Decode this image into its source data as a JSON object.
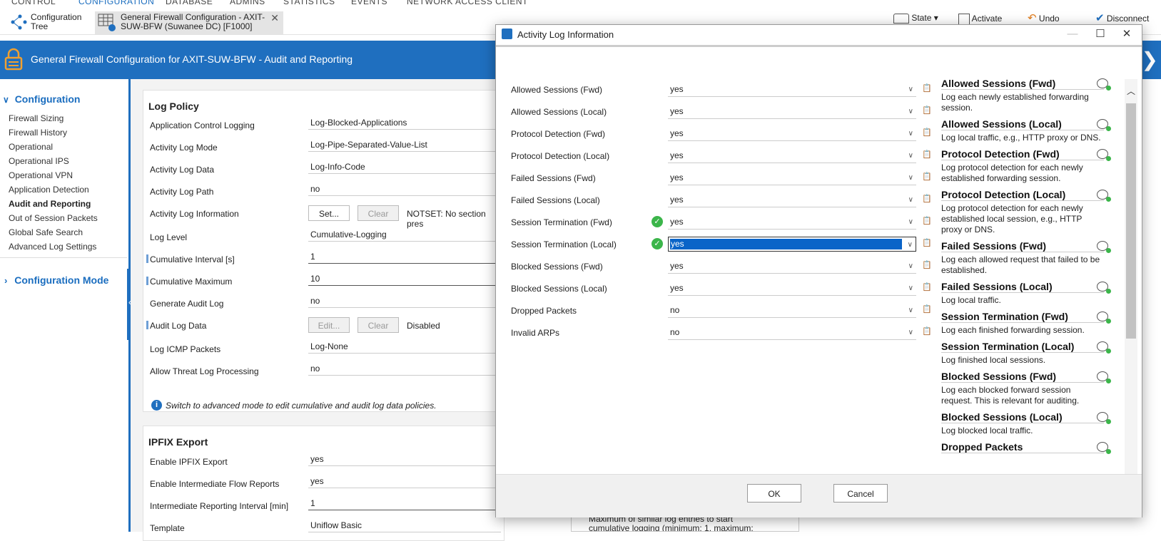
{
  "topnav": [
    "CONTROL",
    "CONFIGURATION",
    "DATABASE",
    "ADMINS",
    "STATISTICS",
    "EVENTS",
    "NETWORK ACCESS CLIENT"
  ],
  "toolbar": {
    "config_tree": [
      "Configuration",
      "Tree"
    ],
    "doc_tab": [
      "General Firewall Configuration - AXIT-",
      "SUW-BFW (Suwanee DC)  [F1000]"
    ],
    "doc_tab_close": "✕",
    "state": "State",
    "activate": "Activate",
    "undo": "Undo",
    "disconnect": "Disconnect"
  },
  "header": {
    "title": "General Firewall Configuration for AXIT-SUW-BFW - Audit and Reporting"
  },
  "sidebar": {
    "section1": "Configuration",
    "items": [
      "Firewall Sizing",
      "Firewall History",
      "Operational",
      "Operational IPS",
      "Operational VPN",
      "Application Detection",
      "Audit and Reporting",
      "Out of Session Packets",
      "Global Safe Search",
      "Advanced Log Settings"
    ],
    "section2": "Configuration Mode"
  },
  "log_policy": {
    "title": "Log Policy",
    "rows": [
      {
        "label": "Application Control Logging",
        "value": "Log-Blocked-Applications"
      },
      {
        "label": "Activity Log Mode",
        "value": "Log-Pipe-Separated-Value-List"
      },
      {
        "label": "Activity Log Data",
        "value": "Log-Info-Code"
      },
      {
        "label": "Activity Log Path",
        "value": "no"
      },
      {
        "label": "Activity Log Information",
        "value": ""
      },
      {
        "label": "Log Level",
        "value": "Cumulative-Logging"
      },
      {
        "label": "Cumulative Interval [s]",
        "value": "1"
      },
      {
        "label": "Cumulative Maximum",
        "value": "10"
      },
      {
        "label": "Generate Audit Log",
        "value": "no"
      },
      {
        "label": "Audit Log Data",
        "value": ""
      },
      {
        "label": "Log ICMP Packets",
        "value": "Log-None"
      },
      {
        "label": "Allow Threat Log Processing",
        "value": "no"
      }
    ],
    "set_button": "Set...",
    "clear_button": "Clear",
    "notset_text": "NOTSET: No section pres",
    "edit_button": "Edit...",
    "clear_button2": "Clear",
    "disabled_text": "Disabled",
    "info_text": "Switch to advanced mode to edit cumulative and audit log data policies."
  },
  "ipfix": {
    "title": "IPFIX Export",
    "rows": [
      {
        "label": "Enable IPFIX Export",
        "value": "yes"
      },
      {
        "label": "Enable Intermediate Flow Reports",
        "value": "yes"
      },
      {
        "label": "Intermediate Reporting Interval [min]",
        "value": "1"
      },
      {
        "label": "Template",
        "value": "Uniflow Basic"
      }
    ],
    "tooltip": [
      "Maximum of similar log entries to start",
      "cumulative logging (minimum: 1, maximum:"
    ]
  },
  "dialog": {
    "title": "Activity Log Information",
    "rows": [
      {
        "label": "Allowed Sessions (Fwd)",
        "value": "yes",
        "check": false
      },
      {
        "label": "Allowed Sessions (Local)",
        "value": "yes",
        "check": false
      },
      {
        "label": "Protocol Detection (Fwd)",
        "value": "yes",
        "check": false
      },
      {
        "label": "Protocol Detection (Local)",
        "value": "yes",
        "check": false
      },
      {
        "label": "Failed Sessions (Fwd)",
        "value": "yes",
        "check": false
      },
      {
        "label": "Failed Sessions (Local)",
        "value": "yes",
        "check": false
      },
      {
        "label": "Session Termination (Fwd)",
        "value": "yes",
        "check": true
      },
      {
        "label": "Session Termination (Local)",
        "value": "yes",
        "check": true,
        "selected": true
      },
      {
        "label": "Blocked Sessions (Fwd)",
        "value": "yes",
        "check": false
      },
      {
        "label": "Blocked Sessions (Local)",
        "value": "yes",
        "check": false
      },
      {
        "label": "Dropped Packets",
        "value": "no",
        "check": false
      },
      {
        "label": "Invalid ARPs",
        "value": "no",
        "check": false
      }
    ],
    "help": [
      {
        "title": "Allowed Sessions (Fwd)",
        "lines": [
          "Log each newly established forwarding",
          "session."
        ]
      },
      {
        "title": "Allowed Sessions (Local)",
        "lines": [
          "Log local traffic, e.g., HTTP proxy or DNS."
        ]
      },
      {
        "title": "Protocol Detection (Fwd)",
        "lines": [
          "Log protocol detection for each newly",
          "established forwarding session."
        ]
      },
      {
        "title": "Protocol Detection (Local)",
        "lines": [
          "Log protocol detection for each newly",
          "established local session, e.g., HTTP",
          "proxy or DNS."
        ]
      },
      {
        "title": "Failed Sessions (Fwd)",
        "lines": [
          "Log each allowed request that failed to be",
          "established."
        ]
      },
      {
        "title": "Failed Sessions (Local)",
        "lines": [
          "Log local traffic."
        ]
      },
      {
        "title": "Session Termination (Fwd)",
        "lines": [
          "Log each finished forwarding session."
        ]
      },
      {
        "title": "Session Termination (Local)",
        "lines": [
          "Log finished local sessions."
        ]
      },
      {
        "title": "Blocked Sessions (Fwd)",
        "lines": [
          "Log each blocked forward session",
          "request. This is relevant for auditing."
        ]
      },
      {
        "title": "Blocked Sessions (Local)",
        "lines": [
          "Log blocked local traffic."
        ]
      },
      {
        "title": "Dropped Packets",
        "lines": []
      }
    ],
    "ok": "OK",
    "cancel": "Cancel"
  }
}
